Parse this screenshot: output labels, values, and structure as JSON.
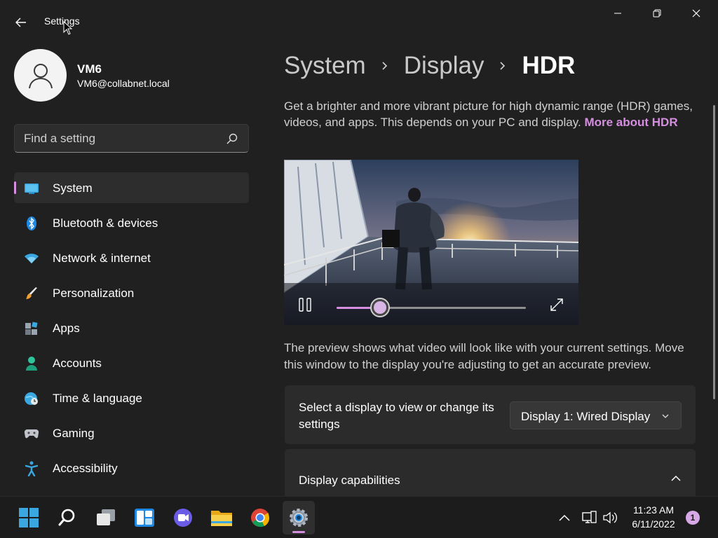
{
  "window": {
    "title": "Settings"
  },
  "profile": {
    "name": "VM6",
    "email": "VM6@collabnet.local"
  },
  "search": {
    "placeholder": "Find a setting"
  },
  "sidebar": {
    "items": [
      {
        "label": "System",
        "icon": "system-monitor-icon",
        "selected": true
      },
      {
        "label": "Bluetooth & devices",
        "icon": "bluetooth-icon"
      },
      {
        "label": "Network & internet",
        "icon": "wifi-icon"
      },
      {
        "label": "Personalization",
        "icon": "paintbrush-icon"
      },
      {
        "label": "Apps",
        "icon": "apps-icon"
      },
      {
        "label": "Accounts",
        "icon": "accounts-icon"
      },
      {
        "label": "Time & language",
        "icon": "time-language-icon"
      },
      {
        "label": "Gaming",
        "icon": "gamepad-icon"
      },
      {
        "label": "Accessibility",
        "icon": "accessibility-icon"
      }
    ]
  },
  "breadcrumb": {
    "parts": [
      "System",
      "Display"
    ],
    "current": "HDR"
  },
  "main": {
    "description": "Get a brighter and more vibrant picture for high dynamic range (HDR) games, videos, and apps. This depends on your PC and display.",
    "more_link": "More about HDR",
    "video": {
      "progress": 0.23
    },
    "preview_note": "The preview shows what video will look like with your current settings. Move this window to the display you're adjusting to get an accurate preview.",
    "display_select": {
      "label": "Select a display to view or change its settings",
      "value": "Display 1: Wired Display"
    },
    "capabilities": {
      "label": "Display capabilities"
    }
  },
  "taskbar": {
    "apps": [
      "start-icon",
      "search-icon",
      "task-view-icon",
      "widgets-icon",
      "teams-chat-icon",
      "file-explorer-icon",
      "chrome-icon",
      "settings-gear-icon"
    ],
    "active_app": "settings-gear-icon",
    "time": "11:23 AM",
    "date": "6/11/2022",
    "notifications": "1"
  },
  "colors": {
    "accent": "#d58ee0",
    "background": "#202020",
    "card": "#2b2b2b"
  }
}
